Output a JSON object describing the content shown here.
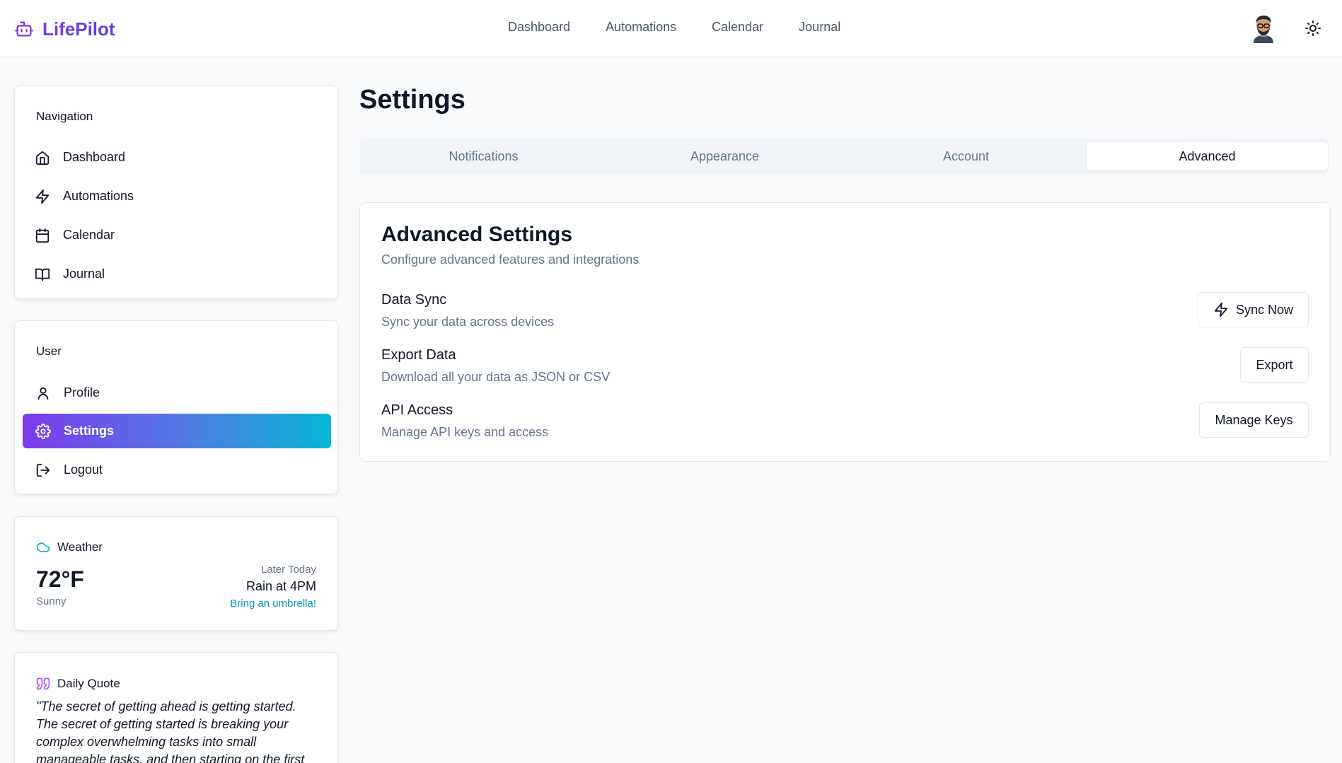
{
  "brand": {
    "name": "LifePilot"
  },
  "topnav": [
    "Dashboard",
    "Automations",
    "Calendar",
    "Journal"
  ],
  "sidebar": {
    "navigation": {
      "title": "Navigation",
      "items": [
        {
          "label": "Dashboard",
          "icon": "home-icon"
        },
        {
          "label": "Automations",
          "icon": "lightning-icon"
        },
        {
          "label": "Calendar",
          "icon": "calendar-icon"
        },
        {
          "label": "Journal",
          "icon": "book-icon"
        }
      ]
    },
    "user": {
      "title": "User",
      "items": [
        {
          "label": "Profile",
          "icon": "user-icon"
        },
        {
          "label": "Settings",
          "icon": "gear-icon",
          "active": true
        },
        {
          "label": "Logout",
          "icon": "logout-icon"
        }
      ]
    },
    "weather": {
      "title": "Weather",
      "temperature": "72°F",
      "condition": "Sunny",
      "later_label": "Later Today",
      "forecast": "Rain at 4PM",
      "tip": "Bring an umbrella!"
    },
    "quote": {
      "title": "Daily Quote",
      "text": "\"The secret of getting ahead is getting started. The secret of getting started is breaking your complex overwhelming tasks into small manageable tasks, and then starting on the first"
    }
  },
  "main": {
    "title": "Settings",
    "tabs": [
      "Notifications",
      "Appearance",
      "Account",
      "Advanced"
    ],
    "active_tab": "Advanced",
    "card": {
      "title": "Advanced Settings",
      "subtitle": "Configure advanced features and integrations",
      "rows": [
        {
          "title": "Data Sync",
          "description": "Sync your data across devices",
          "button": "Sync Now"
        },
        {
          "title": "Export Data",
          "description": "Download all your data as JSON or CSV",
          "button": "Export"
        },
        {
          "title": "API Access",
          "description": "Manage API keys and access",
          "button": "Manage Keys"
        }
      ]
    }
  },
  "colors": {
    "brand_purple": "#7c3aed",
    "active_gradient_start": "#7c3aed",
    "active_gradient_end": "#06b6d4",
    "accent_cyan": "#0891b2"
  }
}
